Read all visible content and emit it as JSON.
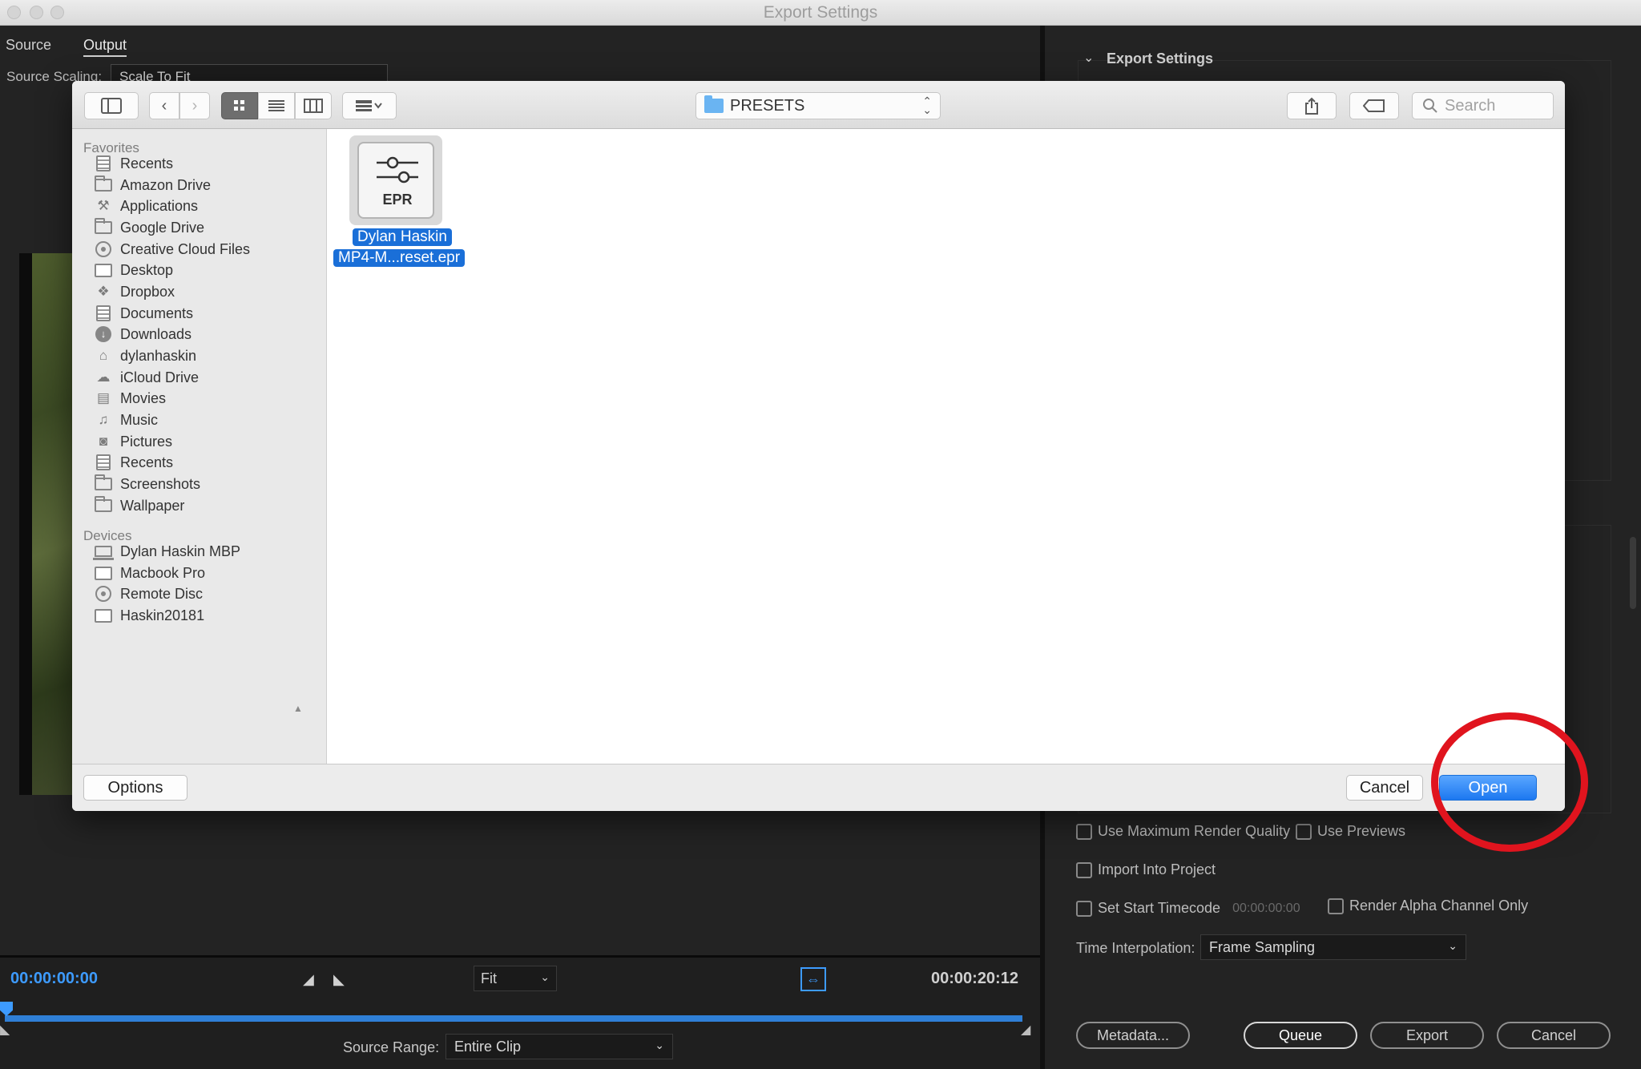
{
  "window": {
    "title": "Export Settings"
  },
  "left_panel": {
    "tabs": [
      "Source",
      "Output"
    ],
    "source_scaling": {
      "label": "Source Scaling:",
      "value": "Scale To Fit"
    },
    "timecode_start": "00:00:00:00",
    "timecode_end": "00:00:20:12",
    "zoom": "Fit",
    "source_range": {
      "label": "Source Range:",
      "value": "Entire Clip"
    }
  },
  "right_panel": {
    "section_title": "Export Settings",
    "checkboxes": {
      "max_render": {
        "label": "Use Maximum Render Quality",
        "checked": false
      },
      "use_previews": {
        "label": "Use Previews",
        "checked": false
      },
      "import_project": {
        "label": "Import Into Project",
        "checked": false
      },
      "start_timecode": {
        "label": "Set Start Timecode",
        "checked": false,
        "value": "00:00:00:00"
      },
      "alpha_only": {
        "label": "Render Alpha Channel Only",
        "checked": false
      }
    },
    "time_interpolation": {
      "label": "Time Interpolation:",
      "value": "Frame Sampling"
    },
    "buttons": {
      "metadata": "Metadata...",
      "queue": "Queue",
      "export": "Export",
      "cancel": "Cancel"
    }
  },
  "dialog": {
    "location": "PRESETS",
    "search_placeholder": "Search",
    "sidebar": {
      "favorites_header": "Favorites",
      "favorites": [
        {
          "label": "Recents",
          "icon": "recents-icon"
        },
        {
          "label": "Amazon Drive",
          "icon": "folder-icon"
        },
        {
          "label": "Applications",
          "icon": "applications-icon"
        },
        {
          "label": "Google Drive",
          "icon": "folder-icon"
        },
        {
          "label": "Creative Cloud Files",
          "icon": "creative-cloud-icon"
        },
        {
          "label": "Desktop",
          "icon": "desktop-icon"
        },
        {
          "label": "Dropbox",
          "icon": "dropbox-icon"
        },
        {
          "label": "Documents",
          "icon": "documents-icon"
        },
        {
          "label": "Downloads",
          "icon": "downloads-icon"
        },
        {
          "label": "dylanhaskin",
          "icon": "home-icon"
        },
        {
          "label": "iCloud Drive",
          "icon": "icloud-icon"
        },
        {
          "label": "Movies",
          "icon": "movies-icon"
        },
        {
          "label": "Music",
          "icon": "music-icon"
        },
        {
          "label": "Pictures",
          "icon": "pictures-icon"
        },
        {
          "label": "Recents",
          "icon": "recents-icon"
        },
        {
          "label": "Screenshots",
          "icon": "folder-icon"
        },
        {
          "label": "Wallpaper",
          "icon": "folder-icon"
        }
      ],
      "devices_header": "Devices",
      "devices": [
        {
          "label": "Dylan Haskin MBP",
          "icon": "laptop-icon"
        },
        {
          "label": "Macbook Pro",
          "icon": "disk-icon"
        },
        {
          "label": "Remote Disc",
          "icon": "disc-icon"
        },
        {
          "label": "Haskin20181",
          "icon": "drive-icon"
        }
      ]
    },
    "file": {
      "extension": "EPR",
      "name_line1": "Dylan Haskin",
      "name_line2": "MP4-M...reset.epr",
      "selected": true
    },
    "buttons": {
      "options": "Options",
      "cancel": "Cancel",
      "open": "Open"
    },
    "accent_color": "#1a6fd8"
  },
  "annotation": {
    "color": "#e0141e",
    "target": "Open"
  }
}
